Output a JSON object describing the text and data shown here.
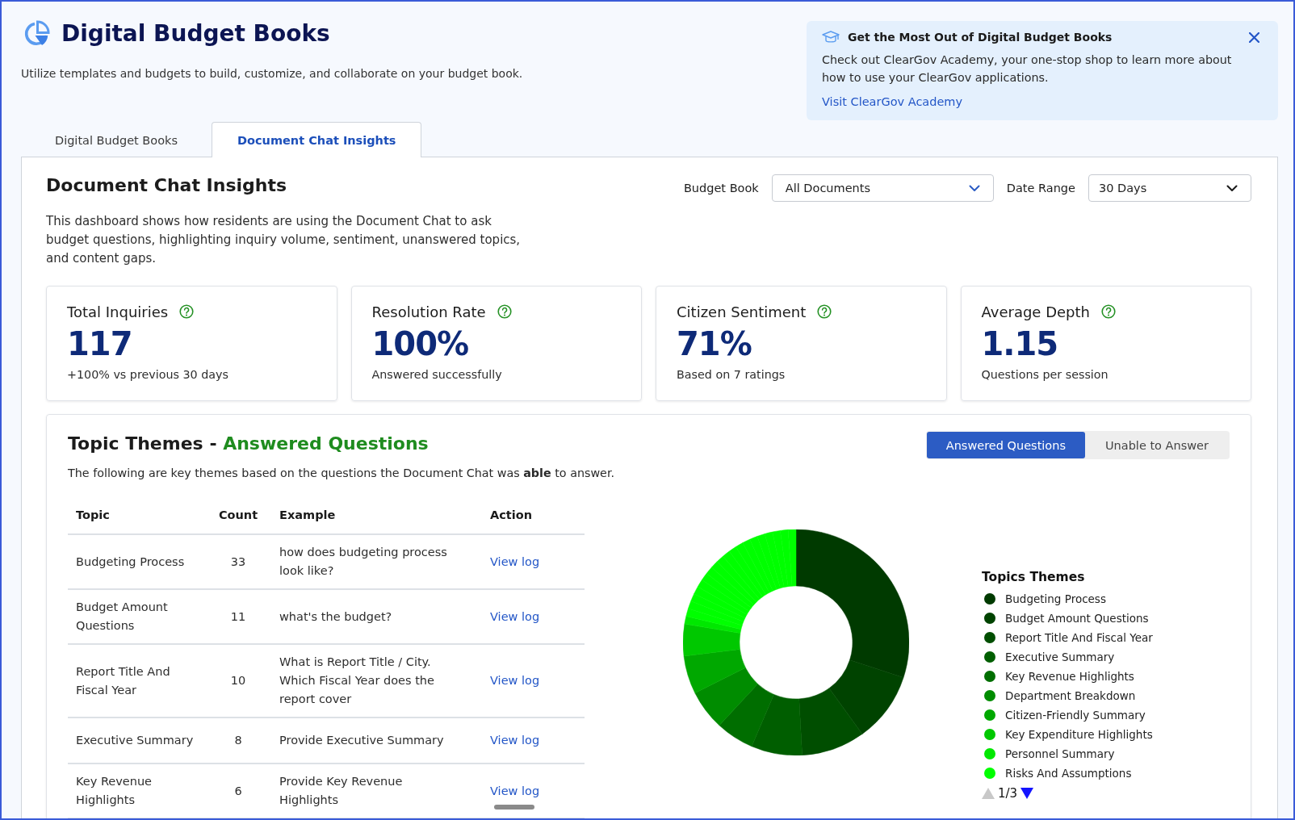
{
  "header": {
    "title": "Digital Budget Books",
    "subtitle": "Utilize templates and budgets to build, customize, and collaborate on your budget book."
  },
  "banner": {
    "title": "Get the Most Out of Digital Budget Books",
    "text": "Check out ClearGov Academy, your one-stop shop to learn more about how to use your ClearGov applications.",
    "link": "Visit ClearGov Academy"
  },
  "tabs": [
    {
      "label": "Digital Budget Books",
      "selected": false
    },
    {
      "label": "Document Chat Insights",
      "selected": true
    }
  ],
  "panel": {
    "title": "Document Chat Insights",
    "filters": [
      {
        "label": "Budget Book",
        "value": "All Documents"
      },
      {
        "label": "Date Range",
        "value": "30 Days"
      }
    ],
    "description": "This dashboard shows how residents are using the Document Chat to ask budget questions, highlighting inquiry volume, sentiment, unanswered topics, and content gaps."
  },
  "metrics": [
    {
      "title": "Total Inquiries",
      "value": "117",
      "note": "+100% vs previous 30 days"
    },
    {
      "title": "Resolution Rate",
      "value": "100%",
      "note": "Answered successfully"
    },
    {
      "title": "Citizen Sentiment",
      "value": "71%",
      "note": "Based on 7 ratings"
    },
    {
      "title": "Average Depth",
      "value": "1.15",
      "note": "Questions per session"
    }
  ],
  "topics": {
    "title": "Topic Themes -",
    "title_highlight": "Answered Questions",
    "toggle": [
      {
        "label": "Answered Questions",
        "selected": true
      },
      {
        "label": "Unable to Answer",
        "selected": false
      }
    ],
    "description": "The following are key themes based on the questions the Document Chat was **able** to answer.",
    "table": {
      "columns": [
        "Topic",
        "Count",
        "Example",
        "Action"
      ],
      "rows": [
        {
          "topic": "Budgeting Process",
          "count": "33",
          "example": "how does budgeting process look like?",
          "action": "View log"
        },
        {
          "topic": "Budget Amount Questions",
          "count": "11",
          "example": "what's the budget?",
          "action": "View log"
        },
        {
          "topic": "Report Title And Fiscal Year",
          "count": "10",
          "example": "What is Report Title / City. Which Fiscal Year does the report cover",
          "action": "View log"
        },
        {
          "topic": "Executive Summary",
          "count": "8",
          "example": "Provide Executive Summary",
          "action": "View log"
        },
        {
          "topic": "Key Revenue Highlights",
          "count": "6",
          "example": "Provide Key Revenue Highlights",
          "action": "View log"
        }
      ]
    },
    "legend": {
      "title": "Topics Themes",
      "items": [
        {
          "label": "Budgeting Process",
          "color": "#003a00"
        },
        {
          "label": "Budget Amount Questions",
          "color": "#004300"
        },
        {
          "label": "Report Title And Fiscal Year",
          "color": "#004e00"
        },
        {
          "label": "Executive Summary",
          "color": "#005e00"
        },
        {
          "label": "Key Revenue Highlights",
          "color": "#006e00"
        },
        {
          "label": "Department Breakdown",
          "color": "#008c00"
        },
        {
          "label": "Citizen-Friendly Summary",
          "color": "#00a800"
        },
        {
          "label": "Key Expenditure Highlights",
          "color": "#00c800"
        },
        {
          "label": "Personnel Summary",
          "color": "#00e800"
        },
        {
          "label": "Risks And Assumptions",
          "color": "#00ff00"
        }
      ],
      "page": "1/3",
      "prev_enabled": false,
      "next_enabled": true
    }
  }
}
